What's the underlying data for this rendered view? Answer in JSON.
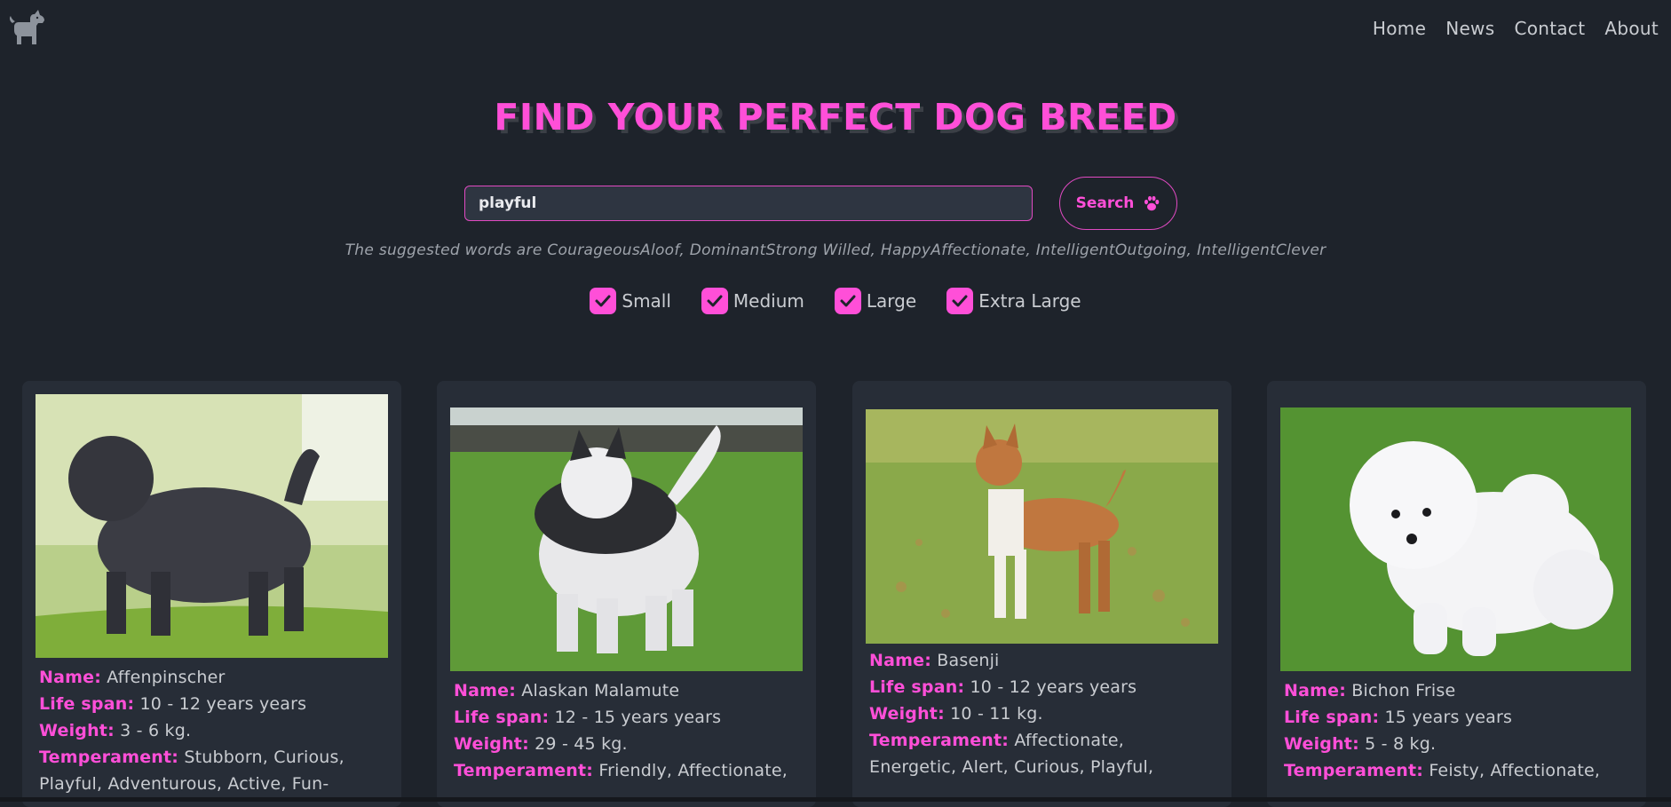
{
  "nav": {
    "items": [
      "Home",
      "News",
      "Contact",
      "About"
    ]
  },
  "icons": {
    "logo": "dog-icon",
    "search": "paw-icon",
    "check": "check-icon"
  },
  "colors": {
    "accent": "#ff4fd8",
    "background": "#1e232b",
    "card": "#272d37"
  },
  "hero": {
    "title": "FIND YOUR PERFECT DOG BREED"
  },
  "search": {
    "value": "playful",
    "button_label": "Search",
    "suggestions": "The suggested words are CourageousAloof, DominantStrong Willed, HappyAffectionate, IntelligentOutgoing, IntelligentClever"
  },
  "filters": [
    {
      "label": "Small",
      "checked": true
    },
    {
      "label": "Medium",
      "checked": true
    },
    {
      "label": "Large",
      "checked": true
    },
    {
      "label": "Extra Large",
      "checked": true
    }
  ],
  "labels": {
    "name": "Name:",
    "life": "Life span:",
    "weight": "Weight:",
    "temp": "Temperament:"
  },
  "breeds": [
    {
      "name": "Affenpinscher",
      "life_span": "10 - 12 years years",
      "weight": "3 - 6 kg.",
      "temperament_lines": [
        "Stubborn, Curious,",
        "Playful, Adventurous, Active, Fun-"
      ]
    },
    {
      "name": "Alaskan Malamute",
      "life_span": "12 - 15 years years",
      "weight": "29 - 45 kg.",
      "temperament_lines": [
        "Friendly, Affectionate,"
      ]
    },
    {
      "name": "Basenji",
      "life_span": "10 - 12 years years",
      "weight": "10 - 11 kg.",
      "temperament_lines": [
        "Affectionate,",
        "Energetic, Alert, Curious, Playful,"
      ]
    },
    {
      "name": "Bichon Frise",
      "life_span": "15 years years",
      "weight": "5 - 8 kg.",
      "temperament_lines": [
        "Feisty, Affectionate,"
      ]
    }
  ]
}
